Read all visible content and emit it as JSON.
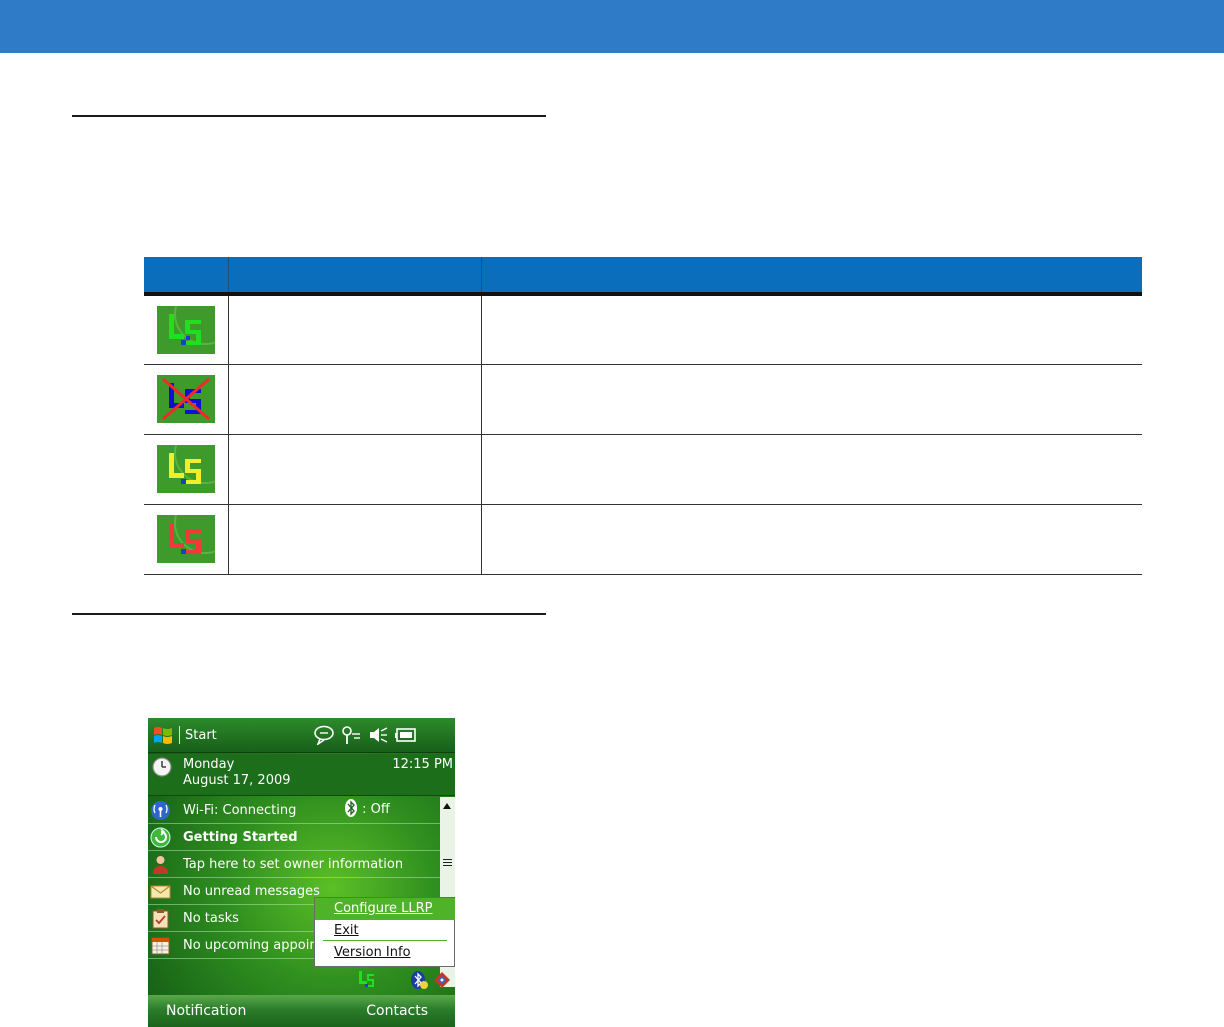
{
  "table": {
    "rows": [
      {
        "icon": "llrp-service-green-icon",
        "icon_color": "#1fe01f"
      },
      {
        "icon": "llrp-service-disabled-icon",
        "icon_color": "#1010d0"
      },
      {
        "icon": "llrp-service-yellow-icon",
        "icon_color": "#f2ef2a"
      },
      {
        "icon": "llrp-service-red-icon",
        "icon_color": "#f03a3a"
      }
    ]
  },
  "phone": {
    "start_label": "Start",
    "day": "Monday",
    "date": "August 17, 2009",
    "time": "12:15 PM",
    "wifi_status": "Wi-Fi: Connecting",
    "bluetooth_status": ": Off",
    "getting_started": "Getting Started",
    "owner_info": "Tap here to set owner information",
    "messages": "No unread messages",
    "tasks": "No tasks",
    "appointments": "No upcoming appointi",
    "menu": {
      "configure": "Configure LLRP",
      "exit": "Exit",
      "version": "Version Info"
    },
    "softkey_left": "Notification",
    "softkey_right": "Contacts"
  },
  "colors": {
    "header_blue": "#2f7bc8",
    "table_header_blue": "#0a6ebd",
    "phone_green": "#2f8f1f",
    "menu_highlight": "#4fb32a"
  }
}
